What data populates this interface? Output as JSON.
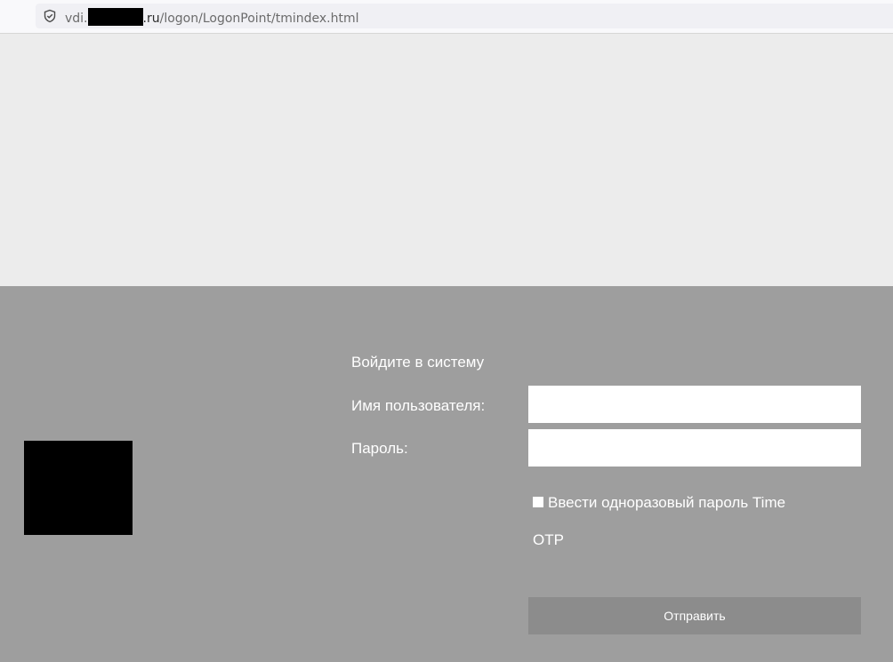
{
  "browser": {
    "url_prefix": "vdi.",
    "url_host_suffix": ".ru",
    "url_path": "/logon/LogonPoint/tmindex.html",
    "security_icon": "shield-check-icon"
  },
  "login": {
    "heading": "Войдите в систему",
    "username_label": "Имя пользователя:",
    "username_value": "",
    "password_label": "Пароль:",
    "password_value": "",
    "otp_label_line1": "Ввести одноразовый пароль Time",
    "otp_label_line2": "OTP",
    "otp_checked": false,
    "submit_label": "Отправить"
  },
  "colors": {
    "top_band": "#ececec",
    "bottom_band": "#9e9e9e",
    "submit_bg": "#8c8c8c",
    "text": "#ffffff"
  }
}
